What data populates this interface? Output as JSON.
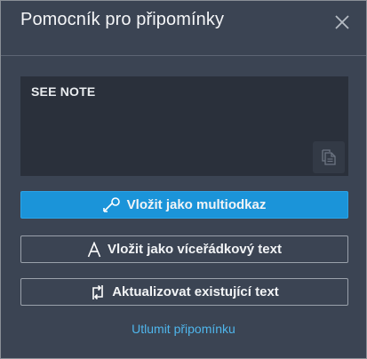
{
  "dialog": {
    "title": "Pomocník pro připomínky",
    "close_icon": "close-icon"
  },
  "note": {
    "text": "SEE NOTE",
    "copy_icon": "copy-icon"
  },
  "buttons": {
    "insert_multileader": {
      "label": "Vložit jako multiodkaz",
      "icon": "multileader-icon"
    },
    "insert_mtext": {
      "label": "Vložit jako víceřádkový text",
      "icon": "text-a-icon"
    },
    "update_text": {
      "label": "Aktualizovat existující text",
      "icon": "refresh-arrows-icon"
    }
  },
  "dismiss_link": "Utlumit připomínku",
  "colors": {
    "background": "#3b4453",
    "note_background": "#2a303b",
    "primary": "#1b94d9",
    "link": "#4fb6ec"
  }
}
